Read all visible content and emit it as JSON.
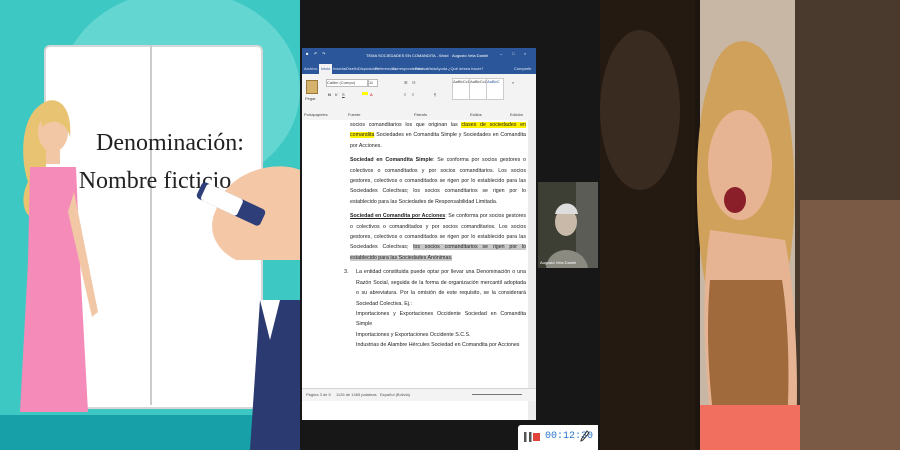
{
  "slide": {
    "line1": "Denominación:",
    "line2": "Nombre ficticio qu"
  },
  "word": {
    "title": "TEMA SOCIEDADES EN COMANDITA - Word",
    "user": "Augusto Vela Daniel",
    "tabs": [
      "Archivo",
      "Inicio",
      "Insertar",
      "Diseño",
      "Disposición",
      "Referencias",
      "Correspondencia",
      "Revisar",
      "Vista",
      "Ayuda",
      "¿Qué desea hacer?",
      "Compartir"
    ],
    "ribbon": {
      "paste": "Pegar",
      "font_name": "Calibri (Cuerpo)",
      "font_size": "11",
      "clipboard": "Portapapeles",
      "font_group": "Fuente",
      "paragraph_group": "Párrafo",
      "styles_group": "Estilos",
      "edit_group": "Edición",
      "style_samples": [
        "AaBbCcDc",
        "AaBbCcDc",
        "AaBbC"
      ]
    },
    "doc": {
      "p0_a": "socios comanditarios los que originan las ",
      "p0_b": "clases de sociedades en comandita",
      "p0_c": " Sociedades en Comandita Simple y Sociedades en Comandita por Acciones.",
      "p1_head": "Sociedad en Comandita Simple",
      "p1_body": ": Se conforma por socios gestores o colectivos o comanditados y por socios comanditarios. Los socios gestores, colectivos o comanditados se rigen por lo establecido para las Sociedades Colectivas; los socios comanditarios se rigen por lo establecido para las Sociedades de Responsabilidad Limitada.",
      "p2_head": "Sociedad en Comandita por Acciones",
      "p2_body": ": Se conforma por socios gestores o colectivos o comanditados y por socios comanditarios. Los socios gestores, colectivos o comanditados se rigen por lo establecido para las Sociedades Colectivas; ",
      "p2_tail": "los socios comanditarios se rigen por lo establecido para las Sociedades Anónimas.",
      "p3_num": "3.",
      "p3_body": "La entidad constituida puede optar por llevar una Denominación o una Razón Social, seguida de la forma de organización mercantil adoptada o su abreviatura. Por la omisión de este requisito, se la considerará Sociedad Colectiva. Ej.:",
      "ex1": "Importaciones y Exportaciones Occidente Sociedad en Comandita Simple",
      "ex2": "Importaciones y Exportaciones Occidente S.C.S.",
      "ex3": "Industrias de Alambre Hércules Sociedad en Comandita por Acciones"
    },
    "status": {
      "page": "Página 3 de 5",
      "words": "1126 de 1465 palabras",
      "lang": "Español (Bolivia)"
    }
  },
  "participant": {
    "name": "Augusto Vela Daniel"
  },
  "recording": {
    "time": "00:12:30"
  },
  "colors": {
    "word_blue": "#2b579a",
    "slide_teal": "#3ec8c4",
    "highlight_yellow": "#fff200",
    "record_red": "#e0443a",
    "timer_blue": "#2b74c9"
  }
}
